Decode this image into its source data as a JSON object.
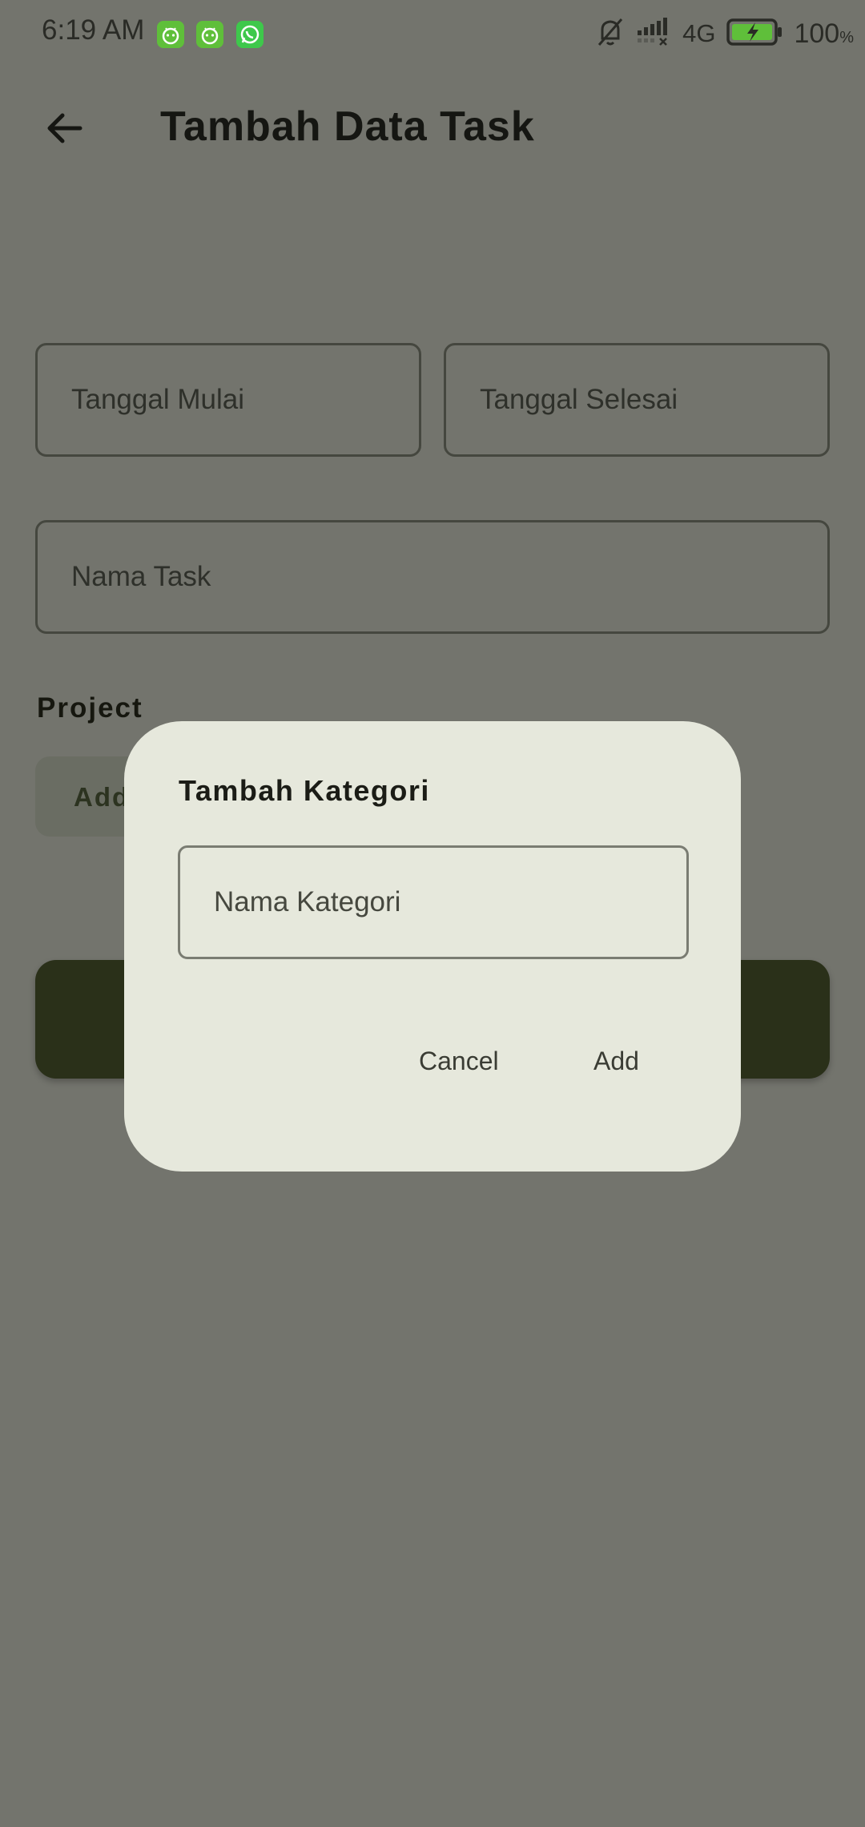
{
  "status_bar": {
    "time": "6:19 AM",
    "network": "4G",
    "battery_percent": "100",
    "battery_unit": "%",
    "app_icons": [
      "android-app-icon",
      "android-app-icon",
      "whatsapp-icon"
    ]
  },
  "app_bar": {
    "title": "Tambah Data Task"
  },
  "form": {
    "start_date_placeholder": "Tanggal Mulai",
    "end_date_placeholder": "Tanggal Selesai",
    "task_name_placeholder": "Nama Task",
    "project_label": "Project",
    "add_chip_label": "Add"
  },
  "dialog": {
    "title": "Tambah Kategori",
    "input_placeholder": "Nama Kategori",
    "cancel_label": "Cancel",
    "add_label": "Add"
  },
  "colors": {
    "scrim_background": "#73746d",
    "dialog_surface": "#e6e8dc",
    "primary_dark": "#2a3019",
    "battery_accent": "#5fbf3a"
  }
}
